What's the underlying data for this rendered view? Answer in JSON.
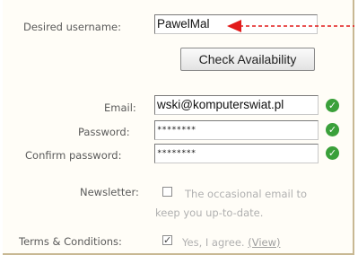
{
  "form": {
    "username_label": "Desired username:",
    "username_value": "PawelMal",
    "check_button": "Check Availability",
    "email_label": "Email:",
    "email_value": "wski@komputerswiat.pl",
    "password_label": "Password:",
    "password_value": "********",
    "confirm_label": "Confirm password:",
    "confirm_value": "********",
    "newsletter_label": "Newsletter:",
    "newsletter_text_1": "The occasional email to",
    "newsletter_text_2": "keep you up-to-date.",
    "newsletter_checked": false,
    "terms_label": "Terms & Conditions:",
    "terms_text": "Yes, I agree.",
    "terms_link": "(View)",
    "terms_checked": true
  },
  "colors": {
    "accent_red": "#e21a1a",
    "valid_green": "#3aa03a"
  },
  "icons": {
    "valid": "check-circle-icon",
    "annotation": "red-arrow-icon"
  }
}
